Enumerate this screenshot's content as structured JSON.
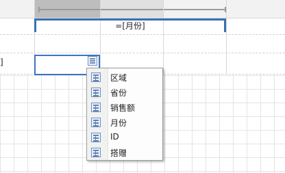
{
  "table": {
    "title_expression": "=[月份]",
    "row_marker": "]"
  },
  "field_menu": {
    "items": [
      {
        "label": "区域",
        "icon": "table-icon"
      },
      {
        "label": "省份",
        "icon": "table-icon"
      },
      {
        "label": "销售额",
        "icon": "table-icon"
      },
      {
        "label": "月份",
        "icon": "table-icon"
      },
      {
        "label": "ID",
        "icon": "table-icon"
      },
      {
        "label": "搭赠",
        "icon": "table-icon"
      }
    ]
  },
  "colors": {
    "selection": "#3b74c4",
    "grid_line": "#e4e4e4",
    "header_selected": "#bdbdbd"
  }
}
